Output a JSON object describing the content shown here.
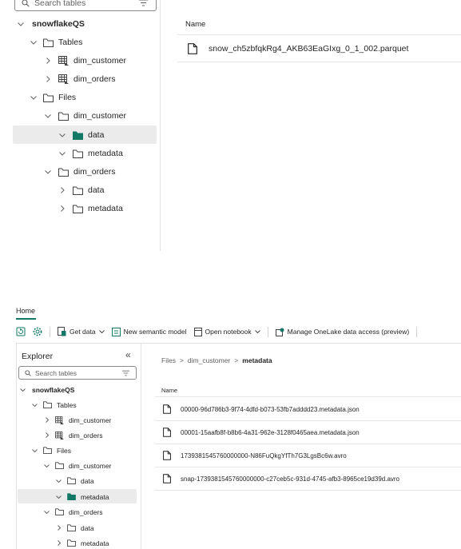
{
  "top": {
    "search": {
      "placeholder": "Search tables"
    },
    "tree": {
      "root": "snowflakeQS",
      "tables": "Tables",
      "table_items": [
        "dim_customer",
        "dim_orders"
      ],
      "files": "Files",
      "dim_customer": "dim_customer",
      "data": "data",
      "metadata": "metadata",
      "dim_orders": "dim_orders",
      "orders_data": "data",
      "orders_metadata": "metadata"
    },
    "content": {
      "name_header": "Name",
      "files": [
        "snow_ch5zbfqkRg4_AKB63EaGIxg_0_1_002.parquet"
      ]
    }
  },
  "bottom": {
    "tab": "Home",
    "toolbar": {
      "get_data": "Get data",
      "new_semantic_model": "New semantic model",
      "open_notebook": "Open notebook",
      "manage_access": "Manage OneLake data access (preview)"
    },
    "explorer": {
      "title": "Explorer",
      "collapse": "«",
      "search_placeholder": "Search tables",
      "root": "snowflakeQS",
      "tables": "Tables",
      "table_items": [
        "dim_customer",
        "dim_orders"
      ],
      "files": "Files",
      "dim_customer": "dim_customer",
      "data": "data",
      "metadata": "metadata",
      "dim_orders": "dim_orders",
      "orders_data": "data",
      "orders_metadata": "metadata"
    },
    "breadcrumb": {
      "part1": "Files",
      "part2": "dim_customer",
      "part3": "metadata",
      "sep": ">"
    },
    "content": {
      "name_header": "Name",
      "files": [
        "00000-96d786b3-9f74-4dfd-b073-53fb7adddd23.metadata.json",
        "00001-15aafb8f-b8b6-4a31-962e-3128f0465aea.metadata.json",
        "1739381545760000000-N86FuQkgYfTh7G3LgsBc6w.avro",
        "snap-1739381545760000000-c27ceb5c-931d-4745-afb3-8965ce19d39d.avro"
      ]
    }
  },
  "colors": {
    "accent": "#117865",
    "selected_bg": "#ebebeb",
    "divider": "#e1e1e1"
  },
  "icons": [
    "search-icon",
    "filter-icon",
    "chevron-down-icon",
    "chevron-right-icon",
    "folder-icon",
    "folder-filled-icon",
    "table-icon",
    "file-icon",
    "refresh-icon",
    "gear-icon"
  ]
}
